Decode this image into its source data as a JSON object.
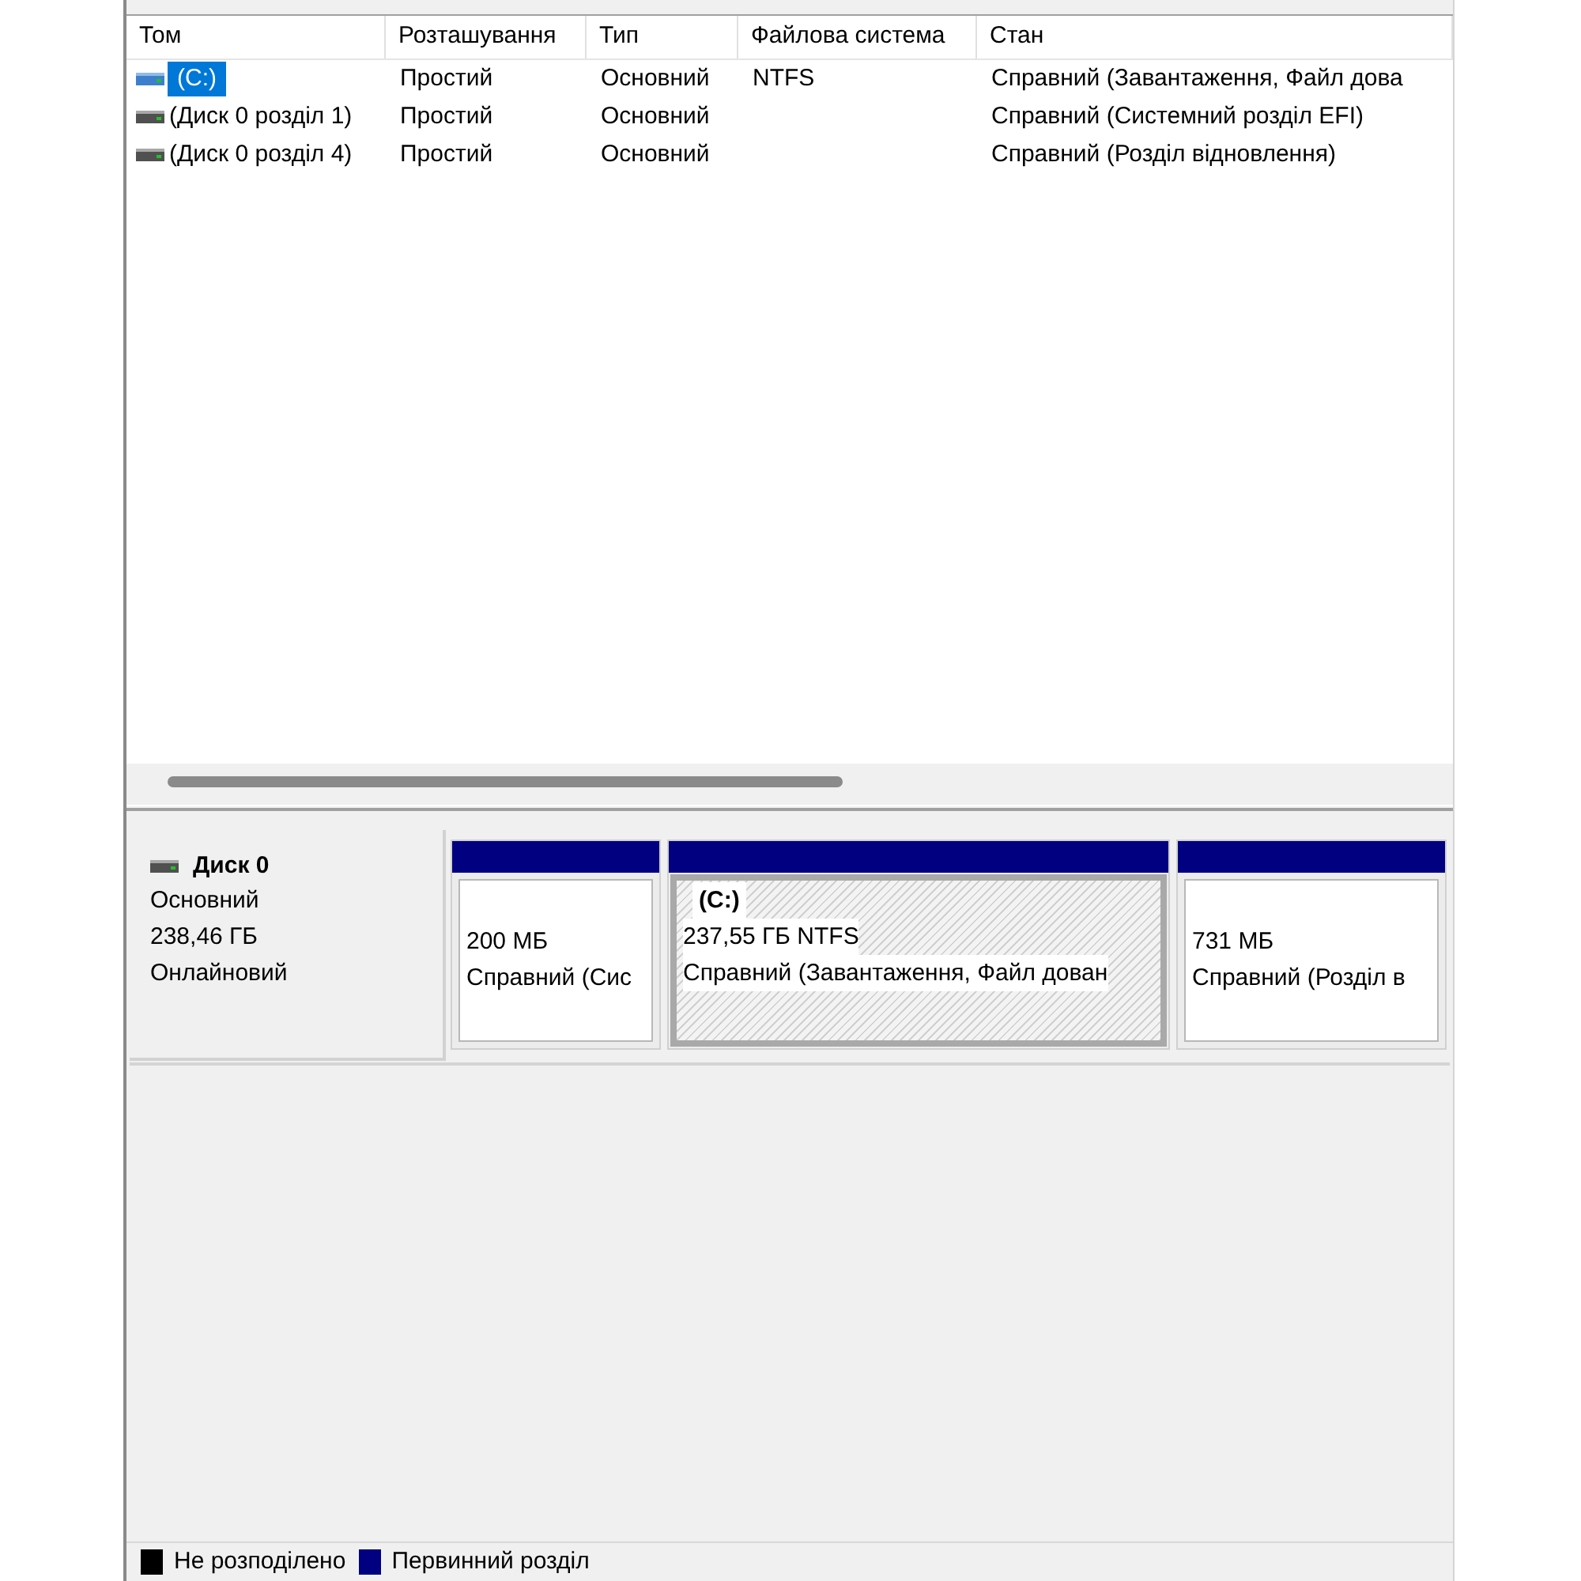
{
  "volume_list": {
    "columns": [
      "Том",
      "Розташування",
      "Тип",
      "Файлова система",
      "Стан"
    ],
    "rows": [
      {
        "volume": "(C:)",
        "selected": true,
        "layout": "Простий",
        "type": "Основний",
        "file_system": "NTFS",
        "status": "Справний (Завантаження, Файл дова"
      },
      {
        "volume": "(Диск 0 розділ 1)",
        "selected": false,
        "layout": "Простий",
        "type": "Основний",
        "status": "Справний (Системний розділ EFI)"
      },
      {
        "volume": "(Диск 0 розділ 4)",
        "selected": false,
        "layout": "Простий",
        "type": "Основний",
        "status": "Справний (Розділ відновлення)"
      }
    ]
  },
  "disks": [
    {
      "name": "Диск 0",
      "type": "Основний",
      "size": "238,46 ГБ",
      "state": "Онлайновий",
      "partitions": [
        {
          "size": "200 МБ",
          "status": "Справний (Сис",
          "selected": false,
          "color": "#000080"
        },
        {
          "label": "(C:)",
          "size": "237,55 ГБ NTFS",
          "status": "Справний (Завантаження, Файл дован",
          "selected": true,
          "color": "#000080"
        },
        {
          "size": "731 МБ",
          "status": "Справний (Розділ в",
          "selected": false,
          "color": "#000080"
        }
      ]
    }
  ],
  "legend": [
    {
      "label": "Не розподілено",
      "color": "#000000"
    },
    {
      "label": "Первинний розділ",
      "color": "#000080"
    }
  ]
}
